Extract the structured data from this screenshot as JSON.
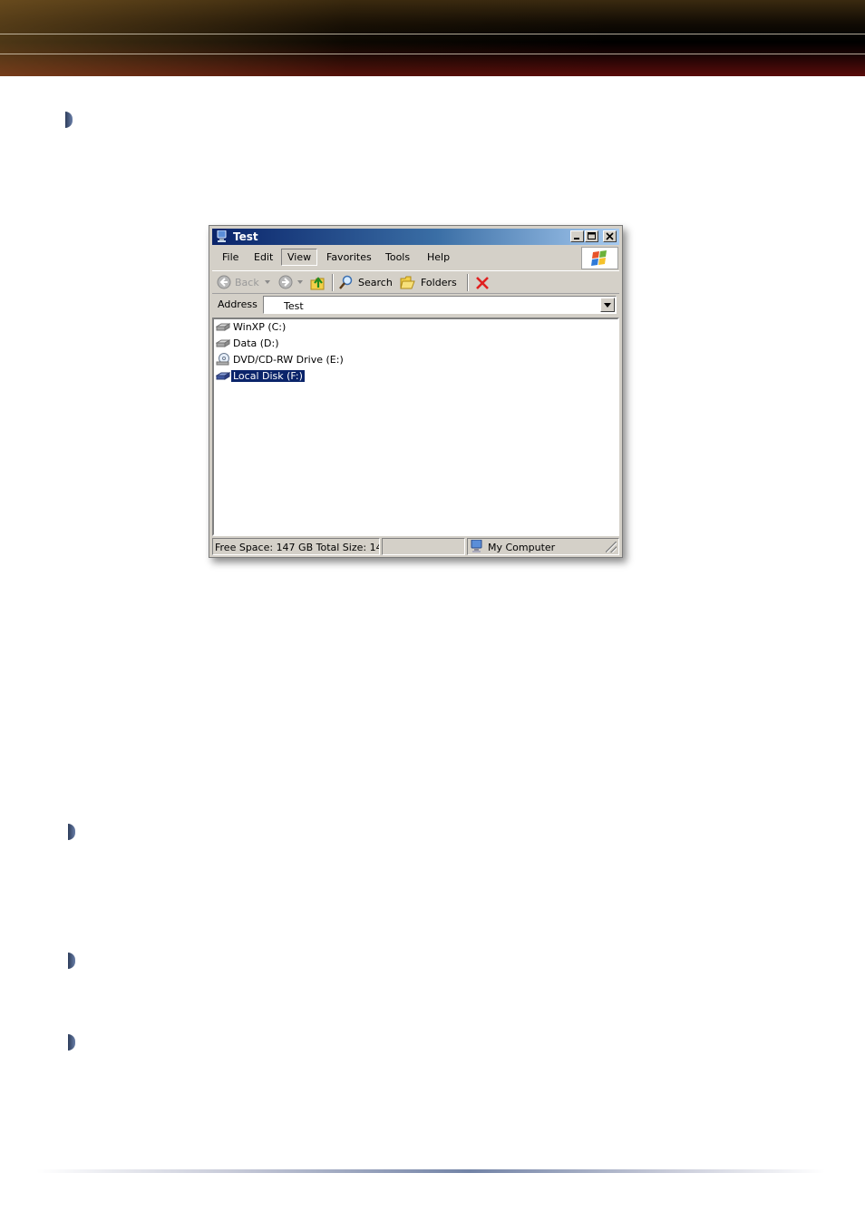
{
  "window": {
    "title": "Test",
    "menu": [
      "File",
      "Edit",
      "View",
      "Favorites",
      "Tools",
      "Help"
    ],
    "active_menu": "View",
    "toolbar": {
      "back_label": "Back",
      "search_label": "Search",
      "folders_label": "Folders"
    },
    "address": {
      "label": "Address",
      "value": "Test"
    },
    "drives": [
      {
        "label": "WinXP (C:)",
        "icon": "hard-drive-icon"
      },
      {
        "label": "Data (D:)",
        "icon": "hard-drive-icon"
      },
      {
        "label": "DVD/CD-RW Drive (E:)",
        "icon": "optical-drive-icon"
      },
      {
        "label": "Local Disk (F:)",
        "icon": "hard-drive-icon",
        "selected": true
      }
    ],
    "status": {
      "space": "Free Space: 147 GB Total Size: 14",
      "location": "My Computer"
    }
  },
  "colors": {
    "titlebar_start": "#0a246a",
    "titlebar_end": "#a6caf0",
    "selection": "#0a246a",
    "bullet": "#4a5e86"
  }
}
